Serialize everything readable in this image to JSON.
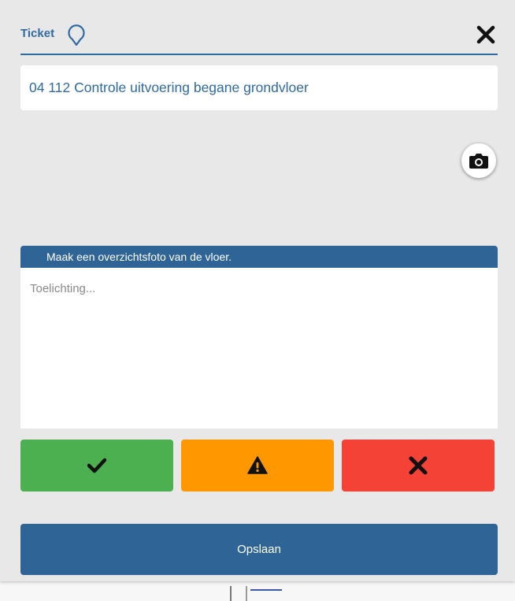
{
  "dialog": {
    "title": "Ticket",
    "title_icon": "map-pin-icon",
    "close_icon": "close-icon",
    "subject": "04 112 Controle uitvoering begane grondvloer",
    "camera_icon": "camera-icon",
    "instruction": "Maak een overzichtsfoto van de vloer.",
    "remark": {
      "value": "",
      "placeholder": "Toelichting..."
    },
    "status_buttons": [
      {
        "icon": "check-icon",
        "color": "#4caf50"
      },
      {
        "icon": "warning-icon",
        "color": "#ff9800"
      },
      {
        "icon": "close-icon",
        "color": "#f44336"
      }
    ],
    "save_label": "Opslaan"
  },
  "colors": {
    "accent": "#2f6aa3",
    "header_bar": "#2f6497",
    "dialog_bg": "#e8e8e8"
  }
}
